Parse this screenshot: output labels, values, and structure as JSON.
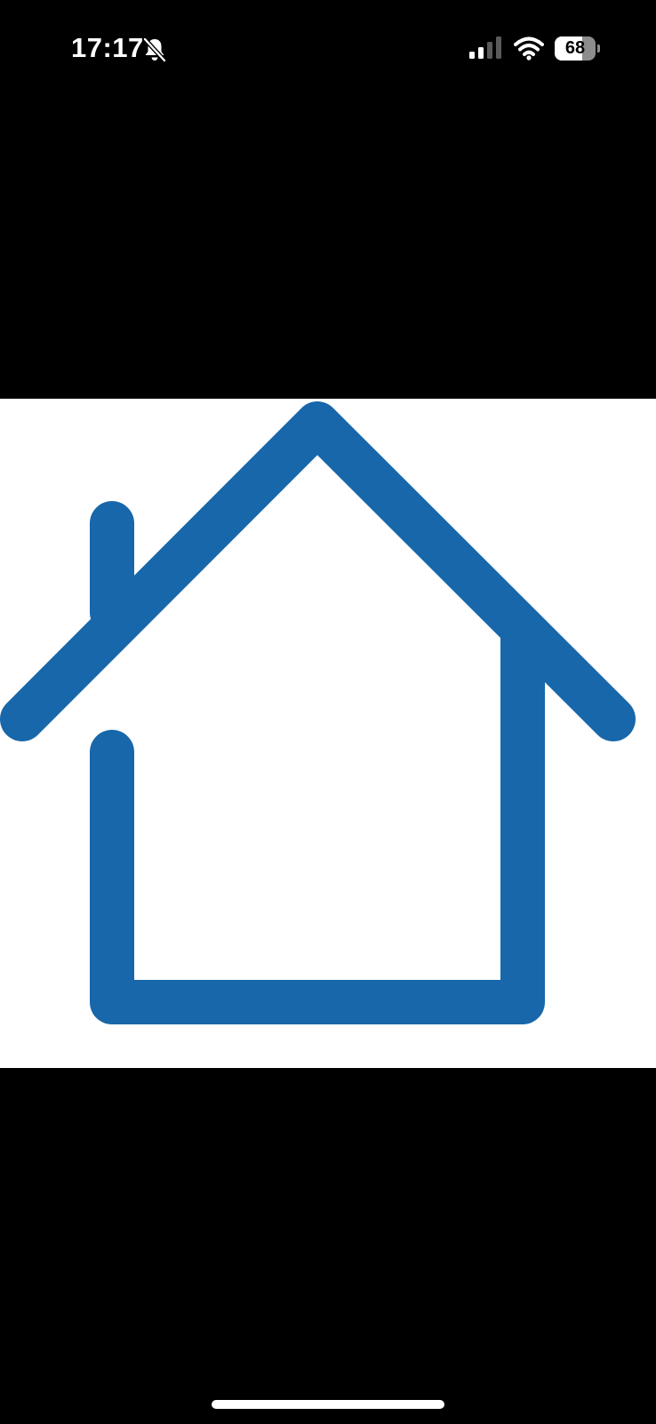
{
  "status_bar": {
    "time": "17:17",
    "silent_icon": "bell-slash-icon",
    "signal_icon": "cellular-signal-icon",
    "signal_bars_active": 2,
    "signal_bars_total": 4,
    "wifi_icon": "wifi-icon",
    "battery_level": "68",
    "battery_fraction": 0.68
  },
  "viewer": {
    "image_icon": "house-icon",
    "image_color": "#1767AA",
    "image_background": "#FFFFFF"
  },
  "system": {
    "home_indicator_color": "#FFFFFF"
  }
}
